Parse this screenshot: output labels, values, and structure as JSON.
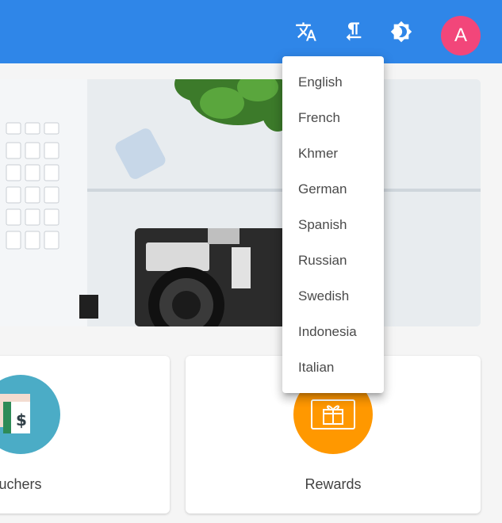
{
  "app_bar": {
    "color": "#2f86e8",
    "actions": [
      {
        "icon": "translate-icon"
      },
      {
        "icon": "text-direction-icon"
      },
      {
        "icon": "brightness-icon"
      }
    ],
    "avatar": {
      "letter": "A",
      "color": "#f2467a"
    }
  },
  "language_menu": {
    "items": [
      {
        "label": "English"
      },
      {
        "label": "French"
      },
      {
        "label": "Khmer"
      },
      {
        "label": "German"
      },
      {
        "label": "Spanish"
      },
      {
        "label": "Russian"
      },
      {
        "label": "Swedish"
      },
      {
        "label": "Indonesia"
      },
      {
        "label": "Italian"
      }
    ]
  },
  "cards": [
    {
      "label": "Vouchers",
      "icon": "voucher-icon",
      "icon_color": "#4bacc6"
    },
    {
      "label": "Rewards",
      "icon": "gift-icon",
      "icon_color": "#ff9800"
    }
  ]
}
